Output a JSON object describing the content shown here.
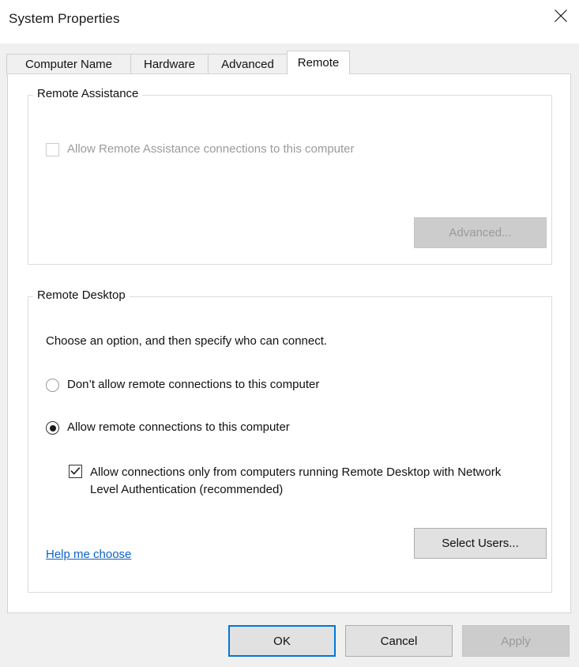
{
  "window": {
    "title": "System Properties",
    "close_icon": "close-icon"
  },
  "tabs": [
    {
      "label": "Computer Name",
      "active": false
    },
    {
      "label": "Hardware",
      "active": false
    },
    {
      "label": "Advanced",
      "active": false
    },
    {
      "label": "Remote",
      "active": true
    }
  ],
  "remote_assistance": {
    "legend": "Remote Assistance",
    "allow_checkbox": {
      "label": "Allow Remote Assistance connections to this computer",
      "checked": false,
      "enabled": false
    },
    "advanced_button": {
      "label": "Advanced...",
      "enabled": false
    }
  },
  "remote_desktop": {
    "legend": "Remote Desktop",
    "instruction": "Choose an option, and then specify who can connect.",
    "options": [
      {
        "label": "Don’t allow remote connections to this computer",
        "selected": false
      },
      {
        "label": "Allow remote connections to this computer",
        "selected": true
      }
    ],
    "nla_checkbox": {
      "label": "Allow connections only from computers running Remote Desktop with Network Level Authentication (recommended)",
      "checked": true,
      "enabled": true
    },
    "help_link": "Help me choose",
    "select_users_button": {
      "label": "Select Users...",
      "enabled": true
    }
  },
  "footer": {
    "ok": {
      "label": "OK",
      "default": true,
      "enabled": true
    },
    "cancel": {
      "label": "Cancel",
      "enabled": true
    },
    "apply": {
      "label": "Apply",
      "enabled": false
    }
  },
  "colors": {
    "accent": "#0078d7",
    "link": "#0b63c5",
    "dialog_bg": "#f0f0f0",
    "panel_bg": "#ffffff",
    "disabled_text": "#9b9b9b"
  }
}
